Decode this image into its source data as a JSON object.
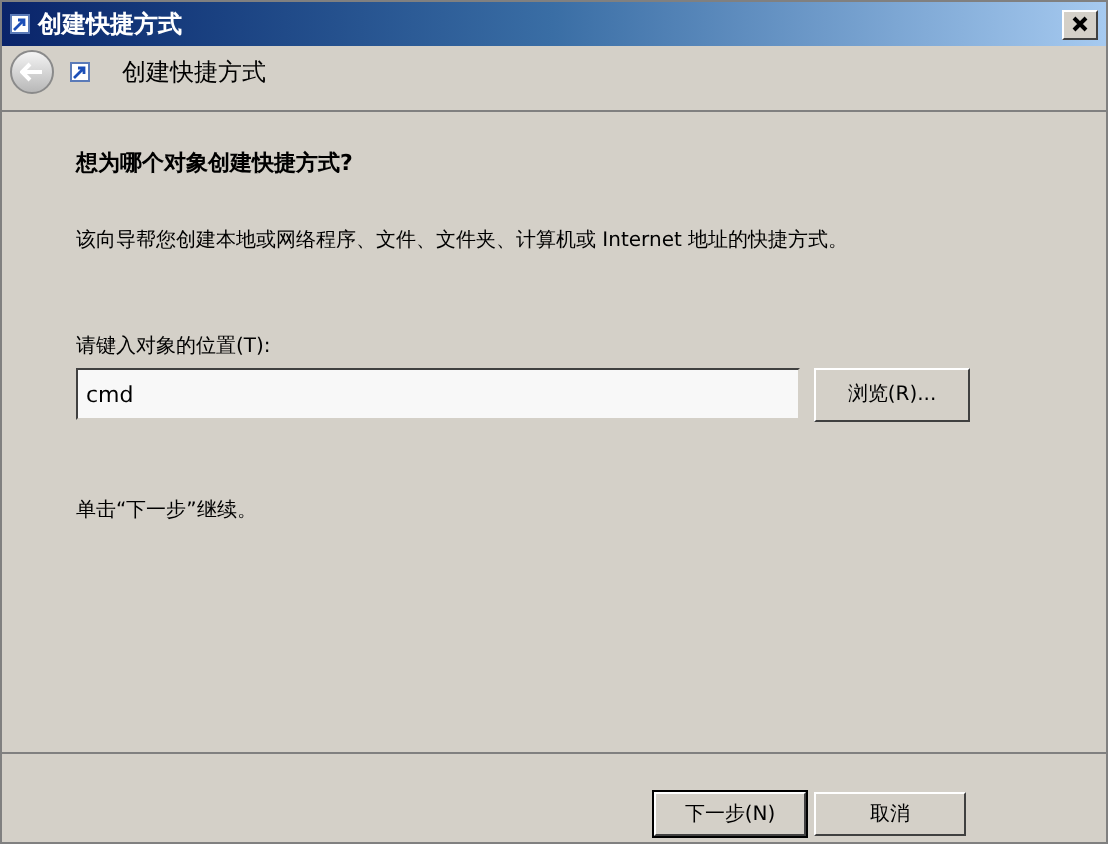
{
  "window": {
    "title": "创建快捷方式"
  },
  "header": {
    "title": "创建快捷方式"
  },
  "heading": "想为哪个对象创建快捷方式?",
  "description": "该向导帮您创建本地或网络程序、文件、文件夹、计算机或 Internet 地址的快捷方式。",
  "location": {
    "label": "请键入对象的位置(T):",
    "value": "cmd",
    "browse": "浏览(R)..."
  },
  "hint": "单击“下一步”继续。",
  "buttons": [
    {
      "label": "下一步(N)",
      "kind": "default"
    },
    {
      "label": "取消",
      "kind": "normal"
    }
  ]
}
